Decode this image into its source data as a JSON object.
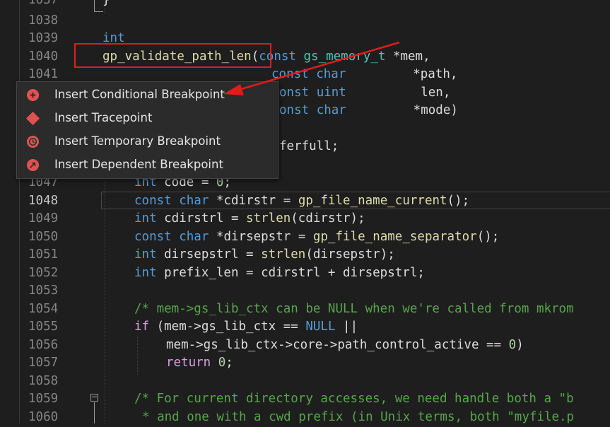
{
  "editor": {
    "line_numbers": [
      "1037",
      "1038",
      "1039",
      "1040",
      "1041",
      "1047",
      "1048",
      "1049",
      "1050",
      "1051",
      "1052",
      "1053",
      "1054",
      "1055",
      "1056",
      "1057",
      "1058",
      "1059",
      "1060"
    ],
    "top_brace": "}",
    "l1039": {
      "t1": "int"
    },
    "l1040": {
      "fn": "gp_validate_path_len",
      "paren": "(",
      "kw": "const",
      "ty": "gs_memory_t",
      "rest": " *mem,"
    },
    "l1041": {
      "kw": "const",
      "ty": "char",
      "rest": "         *path,"
    },
    "l1042": {
      "kw": "onst",
      "ty": "uint",
      "rest": "          len,"
    },
    "l1043": {
      "kw": "onst",
      "ty": "char",
      "rest": "         *mode)"
    },
    "l1045": {
      "id": "ferfull",
      "rest": ";"
    },
    "l1047": {
      "kw": "int",
      "id": " code = ",
      "num": "0",
      "rest": ";"
    },
    "l1048": {
      "kw1": "const",
      "kw2": "char",
      "id": " *cdirstr = ",
      "fn": "gp_file_name_current",
      "rest": "();"
    },
    "l1049": {
      "kw": "int",
      "id": " cdirstrl = ",
      "fn": "strlen",
      "rest": "(cdirstr);"
    },
    "l1050": {
      "kw1": "const",
      "kw2": "char",
      "id": " *dirsepstr = ",
      "fn": "gp_file_name_separator",
      "rest": "();"
    },
    "l1051": {
      "kw": "int",
      "id": " dirsepstrl = ",
      "fn": "strlen",
      "rest": "(dirsepstr);"
    },
    "l1052": {
      "kw": "int",
      "id": " prefix_len = cdirstrl + dirsepstrl;"
    },
    "l1054": {
      "cm": "/* mem->gs_lib_ctx can be NULL when we're called from mkrom"
    },
    "l1055": {
      "ctl": "if",
      "id": " (mem->gs_lib_ctx == ",
      "kw": "NULL",
      "rest": " ||"
    },
    "l1056": {
      "id": "mem->gs_lib_ctx->core->path_control_active == ",
      "num": "0",
      "rest": ")"
    },
    "l1057": {
      "ctl": "return",
      "num": " 0",
      "rest": ";"
    },
    "l1059": {
      "cm": "/* For current directory accesses, we need handle both a \"b"
    },
    "l1060": {
      "cm": "* and one with a cwd prefix (in Unix terms, both \"myfile.p"
    },
    "fold_symbol": "−"
  },
  "context_menu": {
    "items": [
      {
        "label": "Insert Conditional Breakpoint",
        "icon": "conditional-breakpoint-icon"
      },
      {
        "label": "Insert Tracepoint",
        "icon": "tracepoint-icon"
      },
      {
        "label": "Insert Temporary Breakpoint",
        "icon": "temporary-breakpoint-icon"
      },
      {
        "label": "Insert Dependent Breakpoint",
        "icon": "dependent-breakpoint-icon"
      }
    ]
  },
  "colors": {
    "background": "#1e1e1e",
    "annotation_red": "#e21b1b",
    "breakpoint_red": "#e05252"
  }
}
